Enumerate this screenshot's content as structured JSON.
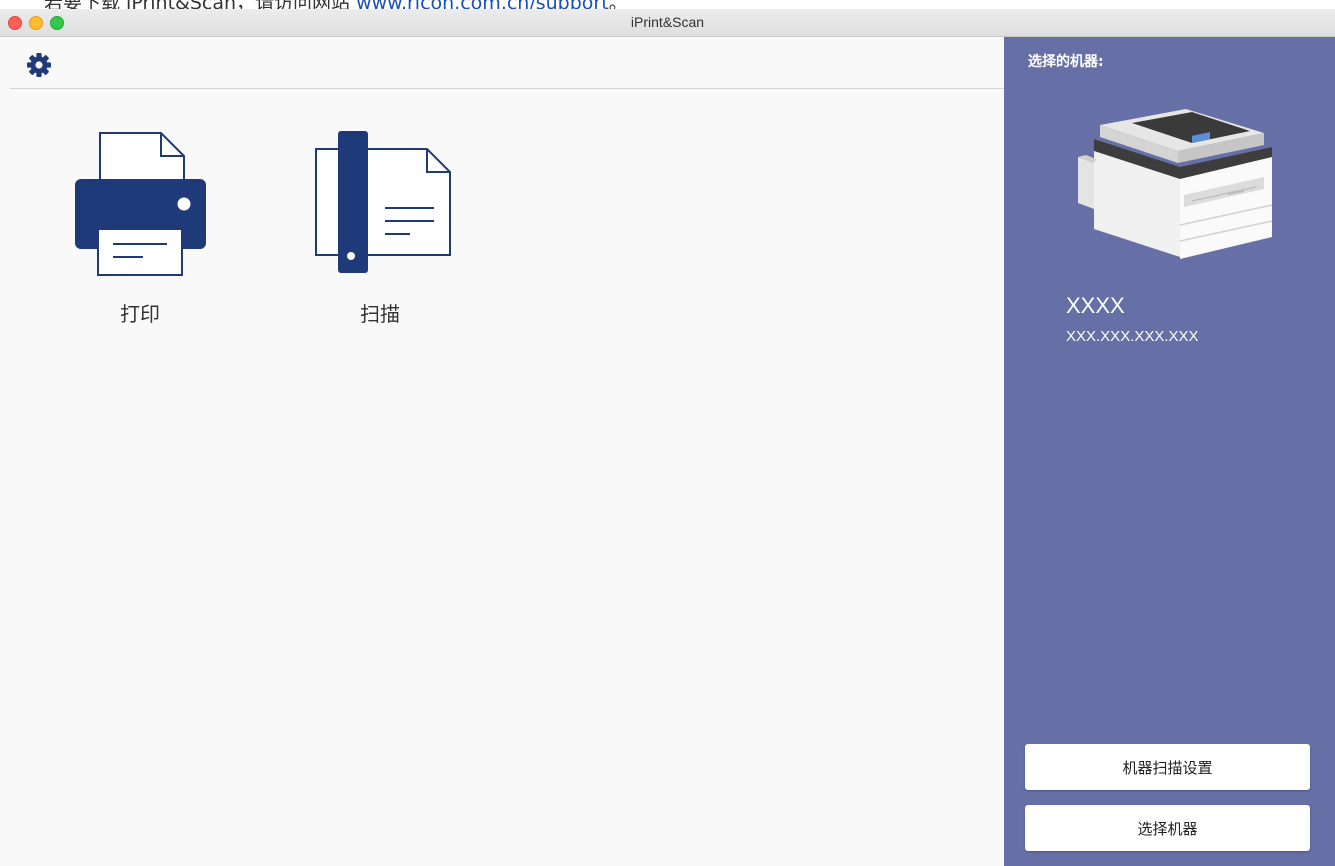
{
  "background_doc": {
    "text": "若要下载 iPrint&Scan，请访问网站 ",
    "link": "www.ricoh.com.cn/support",
    "suffix": "。"
  },
  "window": {
    "title": "iPrint&Scan"
  },
  "toolbar": {
    "settings_icon": "gear-icon"
  },
  "main": {
    "tiles": [
      {
        "label": "打印",
        "icon": "printer-icon"
      },
      {
        "label": "扫描",
        "icon": "scan-document-icon"
      }
    ]
  },
  "sidebar": {
    "heading": "选择的机器:",
    "device": {
      "name": "XXXX",
      "ip": "XXX.XXX.XXX.XXX"
    },
    "buttons": {
      "scan_settings": "机器扫描设置",
      "select_device": "选择机器"
    }
  },
  "colors": {
    "icon_blue": "#1e3a78",
    "sidebar_bg": "#6670a6",
    "main_bg": "#f9f9f9"
  }
}
